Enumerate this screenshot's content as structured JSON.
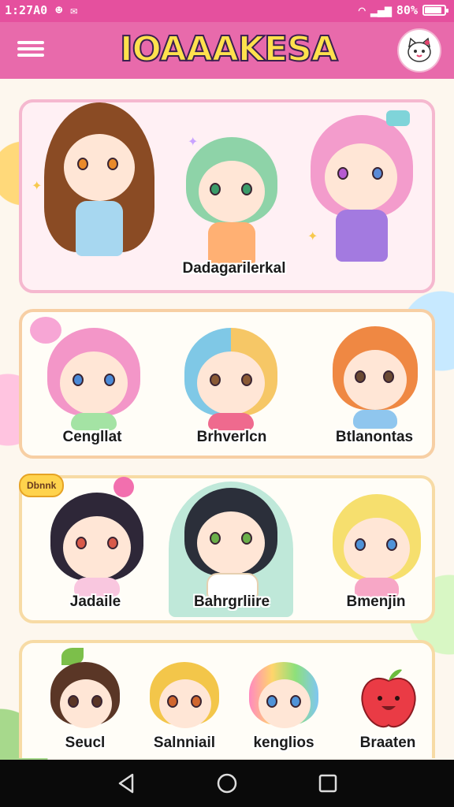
{
  "status_bar": {
    "time": "1:27A0",
    "battery_level": "80%",
    "battery_fraction": 0.8
  },
  "app_bar": {
    "title": "IOAAAKESA",
    "menu_icon": "hamburger-menu-icon",
    "profile_icon": "cat-mascot-icon"
  },
  "colors": {
    "header_pink": "#e86aab",
    "status_pink": "#e5509e",
    "title_yellow": "#ffe14d",
    "card_border_pink": "#f5b8cf",
    "card_border_orange": "#f7cfa4"
  },
  "sections": [
    {
      "characters": [
        {
          "label": "Dadagarilerkal"
        }
      ]
    },
    {
      "characters": [
        {
          "label": "Cengllat"
        },
        {
          "label": "Brhverlcn"
        },
        {
          "label": "Btlanontas"
        }
      ]
    },
    {
      "badge": "Dbnnk",
      "characters": [
        {
          "label": "Jadaile"
        },
        {
          "label": "Bahrgrliire"
        },
        {
          "label": "Bmenjin"
        }
      ]
    },
    {
      "characters": [
        {
          "label": "Seucl"
        },
        {
          "label": "Salnniail"
        },
        {
          "label": "kenglios"
        },
        {
          "label": "Braaten"
        }
      ]
    }
  ],
  "nav_bar": {
    "back_icon": "back-triangle-icon",
    "home_icon": "home-circle-icon",
    "recents_icon": "recents-square-icon"
  }
}
